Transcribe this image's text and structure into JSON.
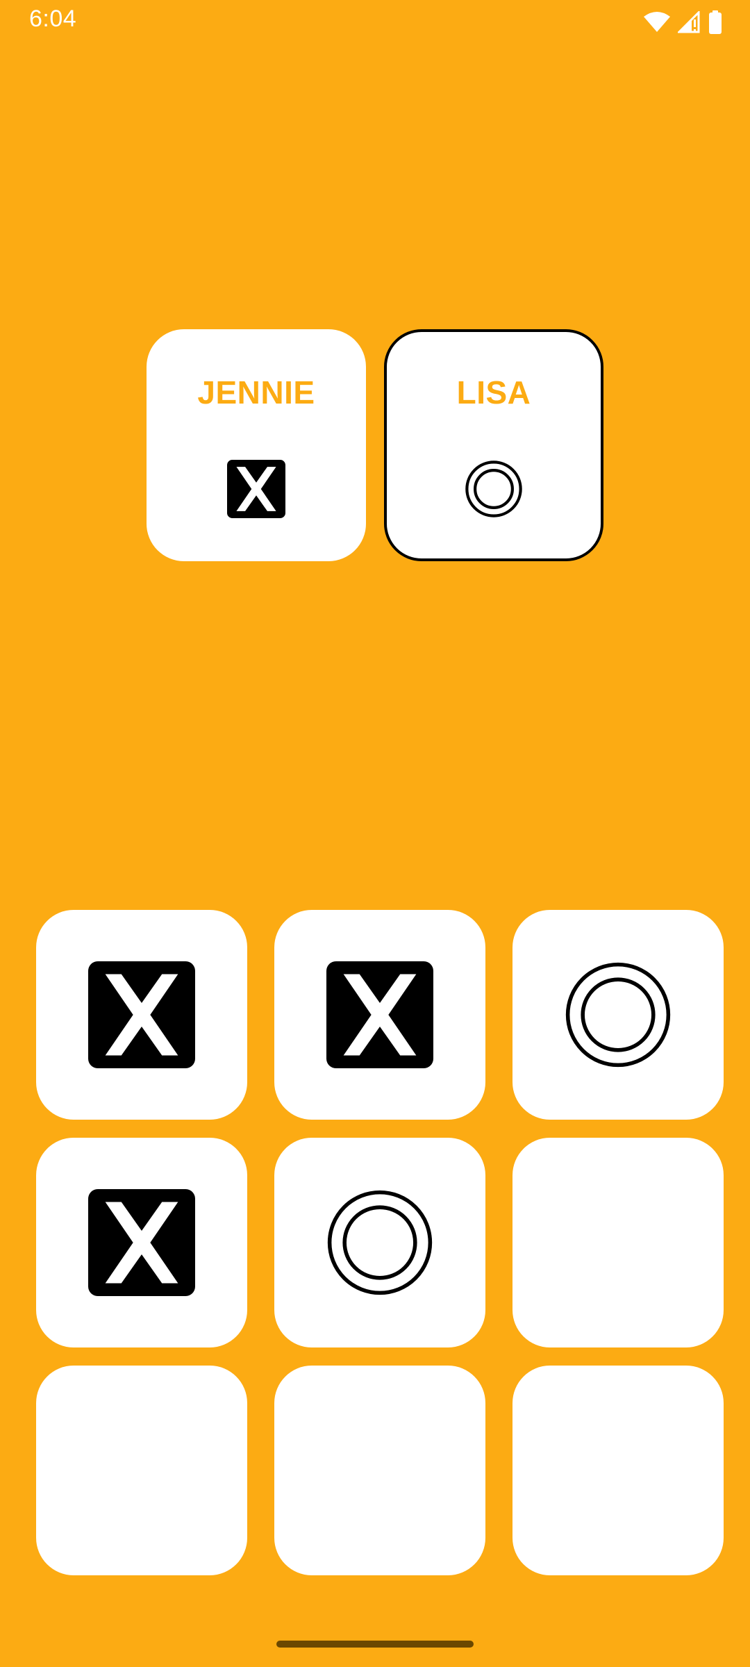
{
  "status_bar": {
    "time": "6:04",
    "icons": [
      "wifi-icon",
      "signal-icon",
      "battery-icon"
    ]
  },
  "players": [
    {
      "name": "JENNIE",
      "mark": "X",
      "active": false
    },
    {
      "name": "LISA",
      "mark": "O",
      "active": true
    }
  ],
  "board": {
    "cells": [
      "X",
      "X",
      "O",
      "X",
      "O",
      "",
      "",
      "",
      ""
    ]
  },
  "colors": {
    "background": "#FCAB13",
    "card": "#FFFFFF",
    "mark": "#000000",
    "player_name": "#FCAB13"
  }
}
